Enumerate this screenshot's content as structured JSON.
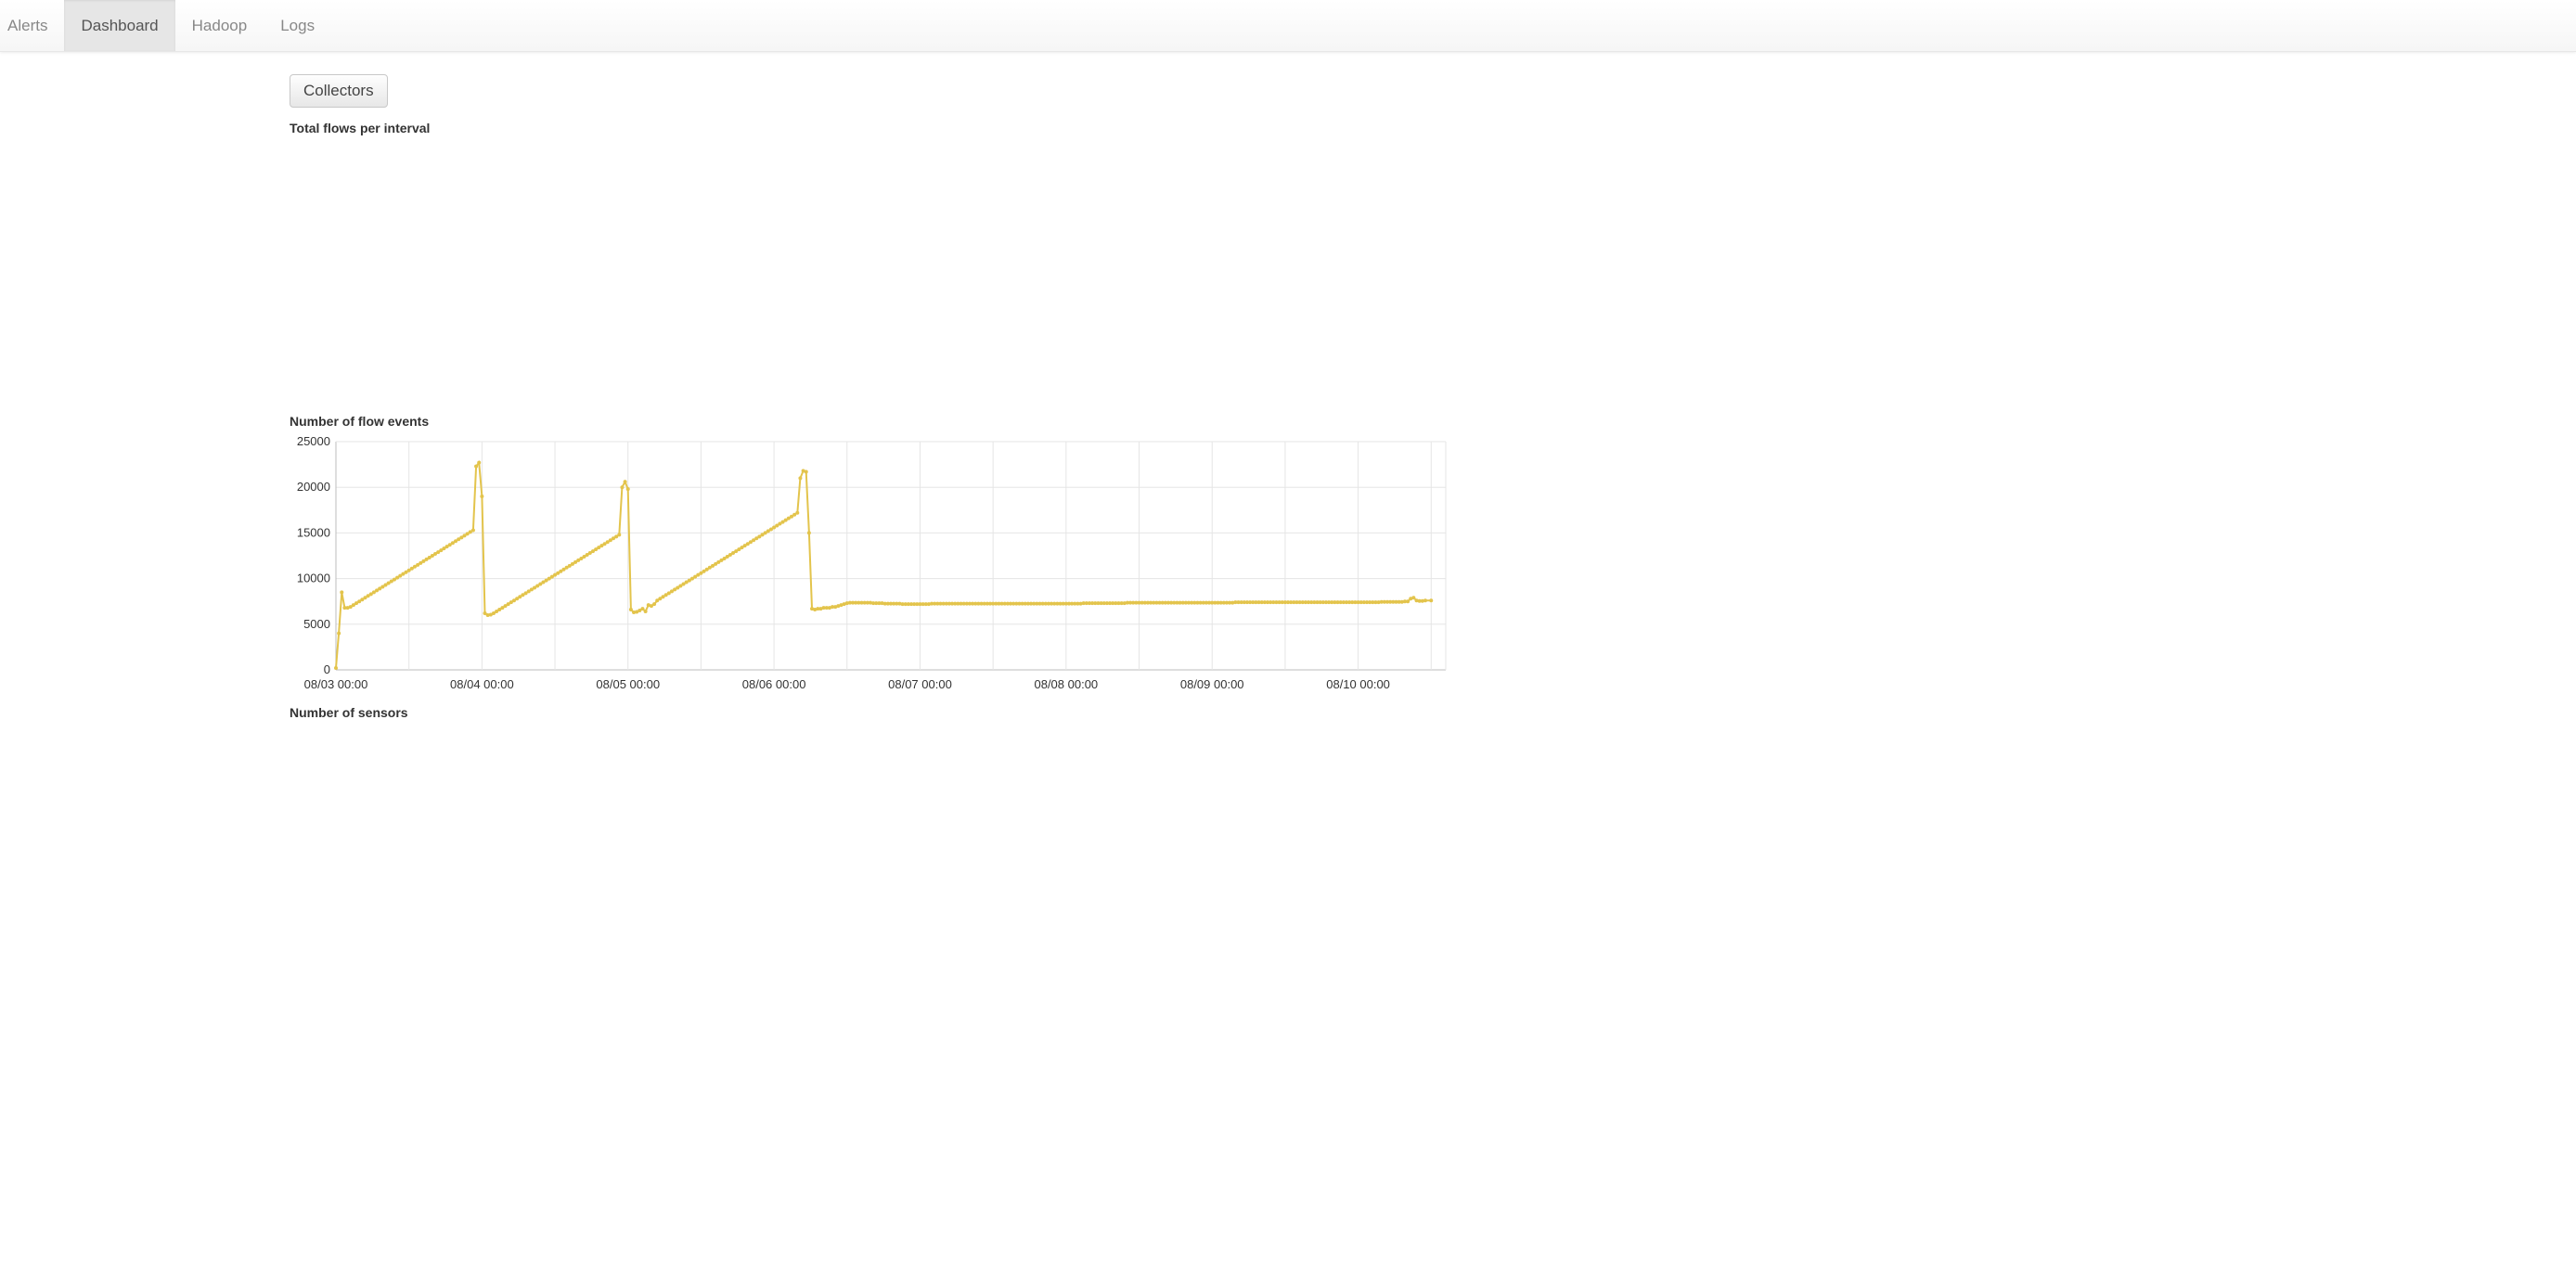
{
  "nav": {
    "tabs": [
      {
        "label": "Alerts",
        "active": false
      },
      {
        "label": "Dashboard",
        "active": true
      },
      {
        "label": "Hadoop",
        "active": false
      },
      {
        "label": "Logs",
        "active": false
      }
    ]
  },
  "toolbar": {
    "collectors_label": "Collectors"
  },
  "sections": {
    "total_flows_label": "Total flows per interval",
    "flow_events_label": "Number of flow events",
    "sensors_label": "Number of sensors"
  },
  "chart_data": {
    "type": "line",
    "title": "Number of flow events",
    "xlabel": "",
    "ylabel": "",
    "ylim": [
      0,
      25000
    ],
    "yticks": [
      0,
      5000,
      10000,
      15000,
      20000,
      25000
    ],
    "xticks_major": [
      "08/03 00:00",
      "08/04 00:00",
      "08/05 00:00",
      "08/06 00:00",
      "08/07 00:00",
      "08/08 00:00",
      "08/09 00:00",
      "08/10 00:00"
    ],
    "color": "#e3c44c",
    "x": [
      0.0,
      0.02,
      0.04,
      0.06,
      0.08,
      0.1,
      0.12,
      0.14,
      0.16,
      0.18,
      0.2,
      0.22,
      0.24,
      0.26,
      0.28,
      0.3,
      0.32,
      0.34,
      0.36,
      0.38,
      0.4,
      0.42,
      0.44,
      0.46,
      0.48,
      0.5,
      0.52,
      0.54,
      0.56,
      0.58,
      0.6,
      0.62,
      0.64,
      0.66,
      0.68,
      0.7,
      0.72,
      0.74,
      0.76,
      0.78,
      0.8,
      0.82,
      0.84,
      0.86,
      0.88,
      0.9,
      0.92,
      0.94,
      0.96,
      0.98,
      1.0,
      1.02,
      1.04,
      1.06,
      1.08,
      1.1,
      1.12,
      1.14,
      1.16,
      1.18,
      1.2,
      1.22,
      1.24,
      1.26,
      1.28,
      1.3,
      1.32,
      1.34,
      1.36,
      1.38,
      1.4,
      1.42,
      1.44,
      1.46,
      1.48,
      1.5,
      1.52,
      1.54,
      1.56,
      1.58,
      1.6,
      1.62,
      1.64,
      1.66,
      1.68,
      1.7,
      1.72,
      1.74,
      1.76,
      1.78,
      1.8,
      1.82,
      1.84,
      1.86,
      1.88,
      1.9,
      1.92,
      1.94,
      1.96,
      1.98,
      2.0,
      2.02,
      2.04,
      2.06,
      2.08,
      2.1,
      2.12,
      2.14,
      2.16,
      2.18,
      2.2,
      2.22,
      2.24,
      2.26,
      2.28,
      2.3,
      2.32,
      2.34,
      2.36,
      2.38,
      2.4,
      2.42,
      2.44,
      2.46,
      2.48,
      2.5,
      2.52,
      2.54,
      2.56,
      2.58,
      2.6,
      2.62,
      2.64,
      2.66,
      2.68,
      2.7,
      2.72,
      2.74,
      2.76,
      2.78,
      2.8,
      2.82,
      2.84,
      2.86,
      2.88,
      2.9,
      2.92,
      2.94,
      2.96,
      2.98,
      3.0,
      3.02,
      3.04,
      3.06,
      3.08,
      3.1,
      3.12,
      3.14,
      3.16,
      3.18,
      3.2,
      3.22,
      3.24,
      3.26,
      3.28,
      3.3,
      3.32,
      3.34,
      3.36,
      3.38,
      3.4,
      3.42,
      3.44,
      3.46,
      3.48,
      3.5,
      3.52,
      3.54,
      3.56,
      3.58,
      3.6,
      3.62,
      3.64,
      3.66,
      3.68,
      3.7,
      3.72,
      3.74,
      3.76,
      3.78,
      3.8,
      3.82,
      3.84,
      3.86,
      3.88,
      3.9,
      3.92,
      3.94,
      3.96,
      3.98,
      4.0,
      4.02,
      4.04,
      4.06,
      4.08,
      4.1,
      4.12,
      4.14,
      4.16,
      4.18,
      4.2,
      4.22,
      4.24,
      4.26,
      4.28,
      4.3,
      4.32,
      4.34,
      4.36,
      4.38,
      4.4,
      4.42,
      4.44,
      4.46,
      4.48,
      4.5,
      4.52,
      4.54,
      4.56,
      4.58,
      4.6,
      4.62,
      4.64,
      4.66,
      4.68,
      4.7,
      4.72,
      4.74,
      4.76,
      4.78,
      4.8,
      4.82,
      4.84,
      4.86,
      4.88,
      4.9,
      4.92,
      4.94,
      4.96,
      4.98,
      5.0,
      5.02,
      5.04,
      5.06,
      5.08,
      5.1,
      5.12,
      5.14,
      5.16,
      5.18,
      5.2,
      5.22,
      5.24,
      5.26,
      5.28,
      5.3,
      5.32,
      5.34,
      5.36,
      5.38,
      5.4,
      5.42,
      5.44,
      5.46,
      5.48,
      5.5,
      5.52,
      5.54,
      5.56,
      5.58,
      5.6,
      5.62,
      5.64,
      5.66,
      5.68,
      5.7,
      5.72,
      5.74,
      5.76,
      5.78,
      5.8,
      5.82,
      5.84,
      5.86,
      5.88,
      5.9,
      5.92,
      5.94,
      5.96,
      5.98,
      6.0,
      6.02,
      6.04,
      6.06,
      6.08,
      6.1,
      6.12,
      6.14,
      6.16,
      6.18,
      6.2,
      6.22,
      6.24,
      6.26,
      6.28,
      6.3,
      6.32,
      6.34,
      6.36,
      6.38,
      6.4,
      6.42,
      6.44,
      6.46,
      6.48,
      6.5,
      6.52,
      6.54,
      6.56,
      6.58,
      6.6,
      6.62,
      6.64,
      6.66,
      6.68,
      6.7,
      6.72,
      6.74,
      6.76,
      6.78,
      6.8,
      6.82,
      6.84,
      6.86,
      6.88,
      6.9,
      6.92,
      6.94,
      6.96,
      6.98,
      7.0,
      7.02,
      7.04,
      7.06,
      7.08,
      7.1,
      7.12,
      7.14,
      7.16,
      7.18,
      7.2,
      7.22,
      7.24,
      7.26,
      7.28,
      7.3,
      7.32,
      7.34,
      7.36,
      7.38,
      7.4,
      7.42,
      7.44,
      7.46,
      7.5
    ],
    "values": [
      200,
      4000,
      8500,
      6800,
      6800,
      6900,
      7100,
      7300,
      7500,
      7700,
      7900,
      8100,
      8300,
      8500,
      8700,
      8900,
      9100,
      9300,
      9500,
      9700,
      9900,
      10100,
      10300,
      10500,
      10700,
      10900,
      11100,
      11300,
      11500,
      11700,
      11900,
      12100,
      12300,
      12500,
      12700,
      12900,
      13100,
      13300,
      13500,
      13700,
      13900,
      14100,
      14300,
      14500,
      14700,
      14900,
      15100,
      15300,
      22300,
      22700,
      19000,
      6200,
      6000,
      6050,
      6200,
      6400,
      6600,
      6800,
      7000,
      7200,
      7400,
      7600,
      7800,
      8000,
      8200,
      8400,
      8600,
      8800,
      9000,
      9200,
      9400,
      9600,
      9800,
      10000,
      10200,
      10400,
      10600,
      10800,
      11000,
      11200,
      11400,
      11600,
      11800,
      12000,
      12200,
      12400,
      12600,
      12800,
      13000,
      13200,
      13400,
      13600,
      13800,
      14000,
      14200,
      14400,
      14600,
      14800,
      20000,
      20600,
      19800,
      6600,
      6300,
      6350,
      6500,
      6700,
      6400,
      7100,
      7000,
      7200,
      7600,
      7800,
      8000,
      8200,
      8400,
      8600,
      8800,
      9000,
      9200,
      9400,
      9600,
      9800,
      10000,
      10200,
      10400,
      10600,
      10800,
      11000,
      11200,
      11400,
      11600,
      11800,
      12000,
      12200,
      12400,
      12600,
      12800,
      13000,
      13200,
      13400,
      13600,
      13800,
      14000,
      14200,
      14400,
      14600,
      14800,
      15000,
      15200,
      15400,
      15600,
      15800,
      16000,
      16200,
      16400,
      16600,
      16800,
      17000,
      17200,
      21000,
      21800,
      21700,
      15000,
      6700,
      6600,
      6700,
      6700,
      6800,
      6800,
      6800,
      6900,
      6900,
      7000,
      7100,
      7200,
      7300,
      7350,
      7350,
      7350,
      7350,
      7350,
      7350,
      7350,
      7350,
      7300,
      7300,
      7300,
      7300,
      7250,
      7250,
      7250,
      7250,
      7250,
      7250,
      7200,
      7200,
      7200,
      7200,
      7200,
      7200,
      7200,
      7200,
      7200,
      7200,
      7250,
      7250,
      7250,
      7250,
      7250,
      7250,
      7250,
      7250,
      7250,
      7250,
      7250,
      7250,
      7250,
      7250,
      7250,
      7250,
      7250,
      7250,
      7250,
      7250,
      7250,
      7250,
      7250,
      7250,
      7250,
      7250,
      7250,
      7250,
      7250,
      7250,
      7250,
      7250,
      7250,
      7250,
      7250,
      7250,
      7250,
      7250,
      7250,
      7250,
      7250,
      7250,
      7250,
      7250,
      7250,
      7250,
      7250,
      7250,
      7250,
      7250,
      7250,
      7250,
      7300,
      7300,
      7300,
      7300,
      7300,
      7300,
      7300,
      7300,
      7300,
      7300,
      7300,
      7300,
      7300,
      7300,
      7300,
      7350,
      7350,
      7350,
      7350,
      7350,
      7350,
      7350,
      7350,
      7350,
      7350,
      7350,
      7350,
      7350,
      7350,
      7350,
      7350,
      7350,
      7350,
      7350,
      7350,
      7350,
      7350,
      7350,
      7350,
      7350,
      7350,
      7350,
      7350,
      7350,
      7350,
      7350,
      7350,
      7350,
      7350,
      7350,
      7350,
      7350,
      7400,
      7400,
      7400,
      7400,
      7400,
      7400,
      7400,
      7400,
      7400,
      7400,
      7400,
      7400,
      7400,
      7400,
      7400,
      7400,
      7400,
      7400,
      7400,
      7400,
      7400,
      7400,
      7400,
      7400,
      7400,
      7400,
      7400,
      7400,
      7400,
      7400,
      7400,
      7400,
      7400,
      7400,
      7400,
      7400,
      7400,
      7400,
      7400,
      7400,
      7400,
      7400,
      7400,
      7400,
      7400,
      7400,
      7400,
      7400,
      7400,
      7400,
      7450,
      7450,
      7450,
      7450,
      7450,
      7450,
      7450,
      7450,
      7500,
      7500,
      7800,
      7900,
      7600,
      7550,
      7550,
      7600,
      7600
    ]
  }
}
